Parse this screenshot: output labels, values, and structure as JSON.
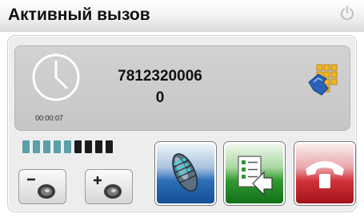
{
  "window": {
    "title": "Активный вызов"
  },
  "call": {
    "number": "7812320006",
    "count": "0",
    "duration": "00:00:07"
  },
  "volume": {
    "level": 5,
    "max": 9
  },
  "icons": {
    "power": "power-icon",
    "clock": "clock-icon",
    "keypad": "keypad-icon",
    "volume_down": "speaker-minus-icon",
    "volume_up": "speaker-plus-icon",
    "microphone": "microphone-icon",
    "menu": "menu-icon",
    "hangup": "phone-hangup-icon"
  },
  "colors": {
    "level_on": "#5aa0a8",
    "level_off": "#1a1a1a",
    "mic_button": "#2c6fb8",
    "menu_button": "#2f9a2f",
    "hangup_button": "#d23339"
  }
}
